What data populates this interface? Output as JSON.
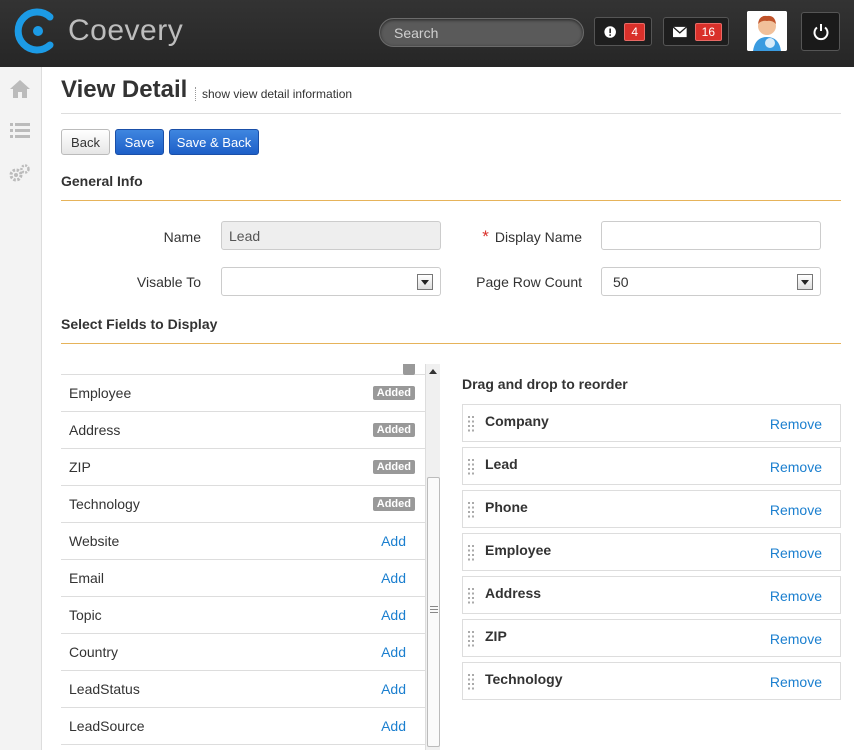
{
  "app": {
    "brand": "Coevery"
  },
  "header": {
    "search_placeholder": "Search",
    "alerts_count": "4",
    "messages_count": "16"
  },
  "page": {
    "title": "View Detail",
    "subtitle": "show view detail information"
  },
  "toolbar": {
    "back": "Back",
    "save": "Save",
    "save_back": "Save & Back"
  },
  "general": {
    "title": "General Info",
    "name_label": "Name",
    "name_value": "Lead",
    "display_name_label": "Display Name",
    "display_name_required": "*",
    "display_name_value": "",
    "visable_to_label": "Visable To",
    "visable_to_value": "",
    "page_row_count_label": "Page Row Count",
    "page_row_count_value": "50"
  },
  "fields": {
    "title": "Select Fields to Display",
    "items": [
      {
        "name": "Employee",
        "status": "Added"
      },
      {
        "name": "Address",
        "status": "Added"
      },
      {
        "name": "ZIP",
        "status": "Added"
      },
      {
        "name": "Technology",
        "status": "Added"
      },
      {
        "name": "Website",
        "status": "Add"
      },
      {
        "name": "Email",
        "status": "Add"
      },
      {
        "name": "Topic",
        "status": "Add"
      },
      {
        "name": "Country",
        "status": "Add"
      },
      {
        "name": "LeadStatus",
        "status": "Add"
      },
      {
        "name": "LeadSource",
        "status": "Add"
      }
    ]
  },
  "reorder": {
    "title": "Drag and drop to reorder",
    "remove_label": "Remove",
    "items": [
      "Company",
      "Lead",
      "Phone",
      "Employee",
      "Address",
      "ZIP",
      "Technology"
    ]
  }
}
